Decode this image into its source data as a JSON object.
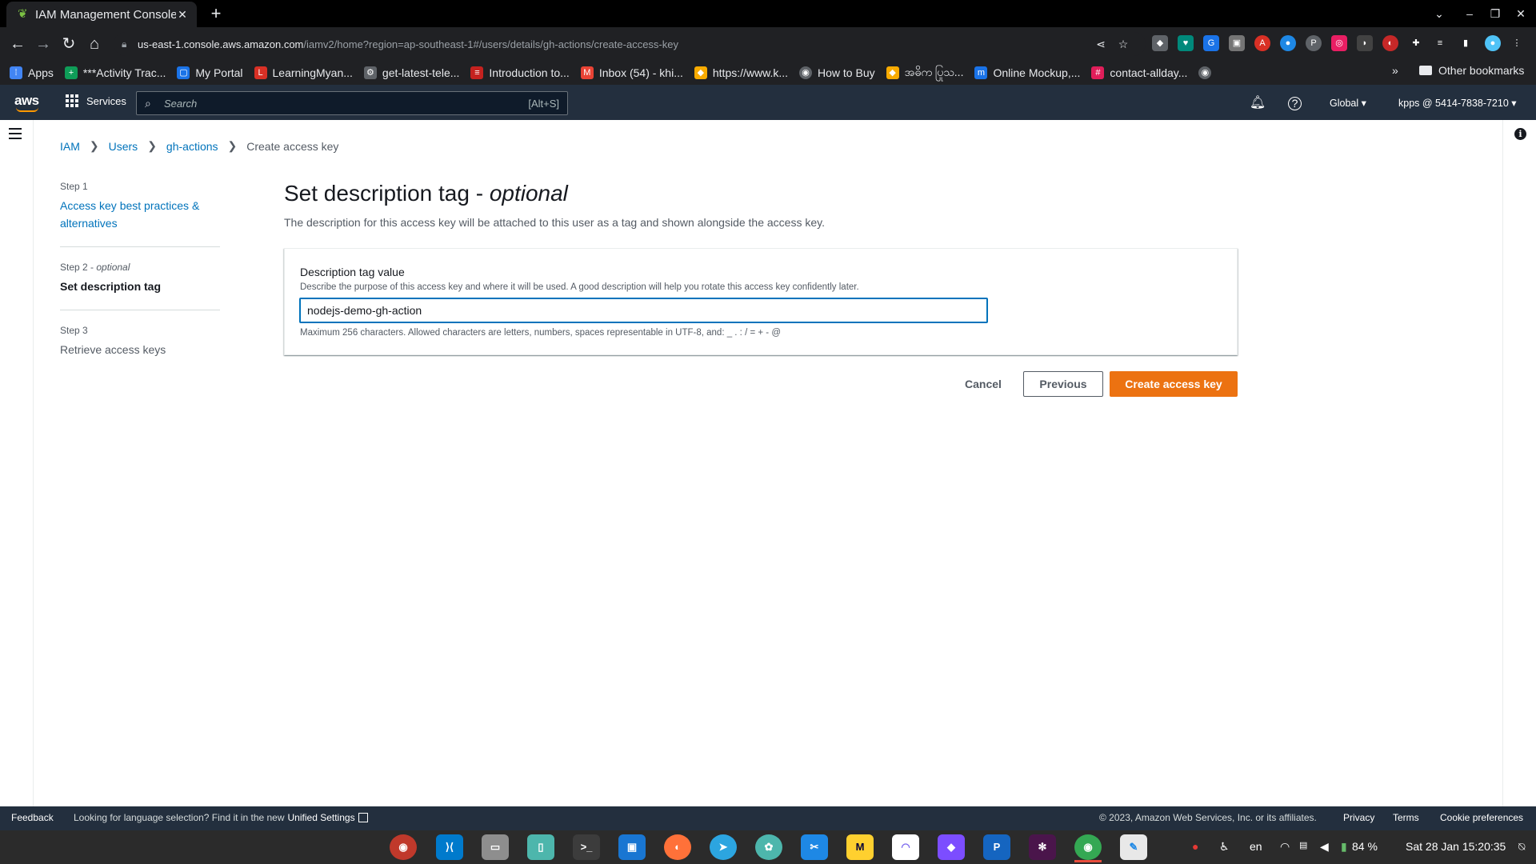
{
  "browser": {
    "tab_title": "IAM Management Console",
    "url_host": "us-east-1.console.aws.amazon.com",
    "url_path": "/iamv2/home?region=ap-southeast-1#/users/details/gh-actions/create-access-key",
    "bookmarks": [
      {
        "label": "Apps",
        "icon": "apps-grid-icon",
        "color": "#4285f4"
      },
      {
        "label": "***Activity Trac...",
        "icon": "plus-icon",
        "color": "#0f9d58"
      },
      {
        "label": "My Portal",
        "icon": "portal-icon",
        "color": "#1a73e8"
      },
      {
        "label": "LearningMyan...",
        "icon": "learning-icon",
        "color": "#d93025"
      },
      {
        "label": "get-latest-tele...",
        "icon": "gear-icon",
        "color": "#5f6368"
      },
      {
        "label": "Introduction to...",
        "icon": "doc-icon",
        "color": "#c5221f"
      },
      {
        "label": "Inbox (54) - khi...",
        "icon": "gmail-icon",
        "color": "#ea4335"
      },
      {
        "label": "https://www.k...",
        "icon": "diamond-icon",
        "color": "#f9ab00"
      },
      {
        "label": "How to Buy",
        "icon": "globe-icon",
        "color": "#5f6368"
      },
      {
        "label": "အဓိက ပြုသ...",
        "icon": "diamond-icon",
        "color": "#f9ab00"
      },
      {
        "label": "Online Mockup,...",
        "icon": "m-icon",
        "color": "#1a73e8"
      },
      {
        "label": "contact-allday...",
        "icon": "hash-icon",
        "color": "#e01e5a"
      }
    ],
    "more_bookmarks": "»",
    "other_bookmarks": "Other bookmarks"
  },
  "aws_nav": {
    "logo": "aws",
    "services": "Services",
    "search_placeholder": "Search",
    "search_shortcut": "[Alt+S]",
    "region": "Global ▾",
    "account": "kpps @ 5414-7838-7210 ▾"
  },
  "breadcrumb": {
    "items": [
      "IAM",
      "Users",
      "gh-actions"
    ],
    "current": "Create access key"
  },
  "steps": [
    {
      "num": "Step 1",
      "optional": "",
      "label": "Access key best practices &",
      "label2": "alternatives",
      "state": "link"
    },
    {
      "num": "Step 2 - ",
      "optional": "optional",
      "label": "Set description tag",
      "label2": "",
      "state": "active"
    },
    {
      "num": "Step 3",
      "optional": "",
      "label": "Retrieve access keys",
      "label2": "",
      "state": "disabled"
    }
  ],
  "main": {
    "title": "Set description tag - ",
    "title_optional": "optional",
    "description": "The description for this access key will be attached to this user as a tag and shown alongside the access key.",
    "field_label": "Description tag value",
    "field_description": "Describe the purpose of this access key and where it will be used. A good description will help you rotate this access key confidently later.",
    "field_value": "nodejs-demo-gh-action",
    "field_constraint": "Maximum 256 characters. Allowed characters are letters, numbers, spaces representable in UTF-8, and: _ . : / = + - @"
  },
  "actions": {
    "cancel": "Cancel",
    "previous": "Previous",
    "create": "Create access key"
  },
  "footer": {
    "feedback": "Feedback",
    "lang_note": "Looking for language selection? Find it in the new",
    "unified_settings": "Unified Settings",
    "copyright": "© 2023, Amazon Web Services, Inc. or its affiliates.",
    "privacy": "Privacy",
    "terms": "Terms",
    "cookie": "Cookie preferences"
  },
  "taskbar": {
    "language": "en",
    "battery": "84 %",
    "datetime": "Sat 28 Jan  15:20:35"
  },
  "colors": {
    "aws_nav": "#232f3e",
    "primary_orange": "#ec7211",
    "link_blue": "#0073bb"
  }
}
